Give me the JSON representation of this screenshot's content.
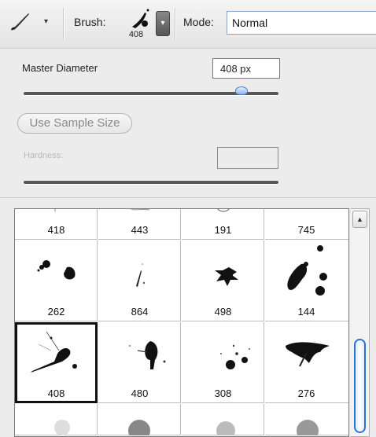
{
  "toolbar": {
    "tool_icon": "brush-tool-icon",
    "tool_caret": "▾",
    "brush_label": "Brush:",
    "brush_size": "408",
    "brush_dropdown_icon": "▾",
    "mode_label": "Mode:",
    "mode_value": "Normal"
  },
  "options": {
    "master_diameter_label": "Master Diameter",
    "master_diameter_value": "408 px",
    "use_sample_size_label": "Use Sample Size",
    "hardness_label": "Hardness:",
    "hardness_value": ""
  },
  "brushes": {
    "row0": [
      "418",
      "443",
      "191",
      "745"
    ],
    "row1": [
      "262",
      "864",
      "498",
      "144"
    ],
    "row2": [
      "408",
      "480",
      "308",
      "276"
    ],
    "selected": "408"
  },
  "scrollbar": {
    "up_arrow": "▲"
  },
  "colors": {
    "accent": "#2b74d6",
    "selection": "#111111"
  }
}
